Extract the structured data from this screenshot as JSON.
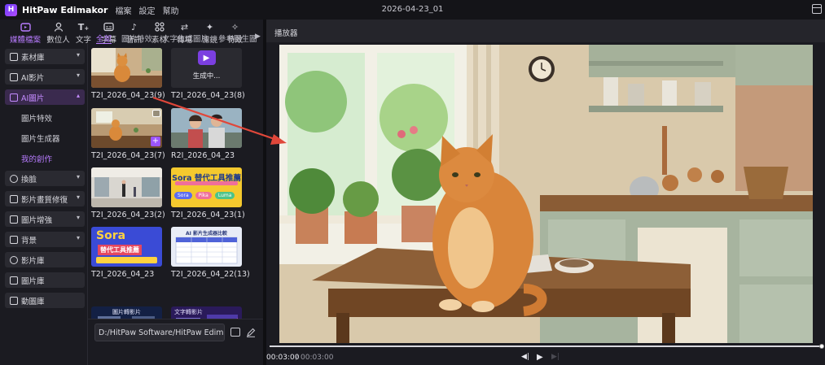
{
  "titlebar": {
    "app_name": "HitPaw Edimakor",
    "menu": [
      "檔案",
      "設定",
      "幫助"
    ],
    "doc_title": "2026-04-23_01"
  },
  "toolbar": {
    "items": [
      {
        "label": "媒體檔案",
        "icon": "folder-media-icon",
        "active": true
      },
      {
        "label": "數位人",
        "icon": "avatar-icon"
      },
      {
        "label": "文字",
        "icon": "text-icon"
      },
      {
        "label": "字幕",
        "icon": "subtitle-icon"
      },
      {
        "label": "音訊",
        "icon": "music-icon"
      },
      {
        "label": "素材",
        "icon": "assets-icon"
      },
      {
        "label": "轉場",
        "icon": "transition-icon"
      },
      {
        "label": "濾鏡",
        "icon": "filter-icon"
      },
      {
        "label": "特效",
        "icon": "effects-icon"
      }
    ]
  },
  "sidebar": {
    "items": [
      {
        "label": "素材庫",
        "chevron": "▾"
      },
      {
        "label": "AI影片",
        "chevron": "▾"
      },
      {
        "label": "AI圖片",
        "chevron": "▴",
        "active": true
      }
    ],
    "subitems": [
      "圖片特效",
      "圖片生成器",
      "我的創作"
    ],
    "items2": [
      {
        "label": "換臉",
        "chevron": "▾"
      },
      {
        "label": "影片畫質修復",
        "chevron": "▾"
      },
      {
        "label": "圖片增強",
        "chevron": "▾"
      },
      {
        "label": "背景",
        "chevron": "▾"
      },
      {
        "label": "影片庫"
      },
      {
        "label": "圖片庫"
      },
      {
        "label": "動圖庫"
      }
    ]
  },
  "media": {
    "tabs": [
      "全部",
      "圖片特效",
      "文字生成圖片",
      "參考圖生圖"
    ],
    "more": "▶",
    "cards": [
      {
        "caption": "T2I_2026_04_23(9)",
        "kind": "cat"
      },
      {
        "caption": "T2I_2026_04_23(8)",
        "kind": "generating",
        "status": "生成中..."
      },
      {
        "caption": "T2I_2026_04_23(7)",
        "kind": "cat-room"
      },
      {
        "caption": "R2I_2026_04_23",
        "kind": "selfie"
      },
      {
        "caption": "T2I_2026_04_23(2)",
        "kind": "mall"
      },
      {
        "caption": "T2I_2026_04_23(1)",
        "kind": "sora-yellow"
      },
      {
        "caption": "T2I_2026_04_23",
        "kind": "sora-blue"
      },
      {
        "caption": "T2I_2026_04_22(13)",
        "kind": "table"
      },
      {
        "caption": "",
        "kind": "dark-a"
      },
      {
        "caption": "",
        "kind": "dark-b"
      }
    ],
    "thumb_text": {
      "sora1_title": "Sora 替代工具推薦",
      "sora1_pills": [
        "Sora",
        "Pika",
        "Luma"
      ],
      "sora2_title": "Sora",
      "sora2_sub": "替代工具推薦",
      "table_title": "AI 影片生成器比較",
      "dark_a_title": "圖片轉影片",
      "dark_b_title": "文字轉影片"
    }
  },
  "path_bar": {
    "value": "D:/HitPaw Software/HitPaw Edimakor..."
  },
  "player": {
    "title": "播放器",
    "time_current": "00:03:00",
    "time_separator": "/",
    "time_total": "00:03:00",
    "controls": [
      "◀|",
      "▶",
      "▶|"
    ]
  },
  "colors": {
    "accent": "#b87cff",
    "annotation_arrow": "#e0473a"
  }
}
